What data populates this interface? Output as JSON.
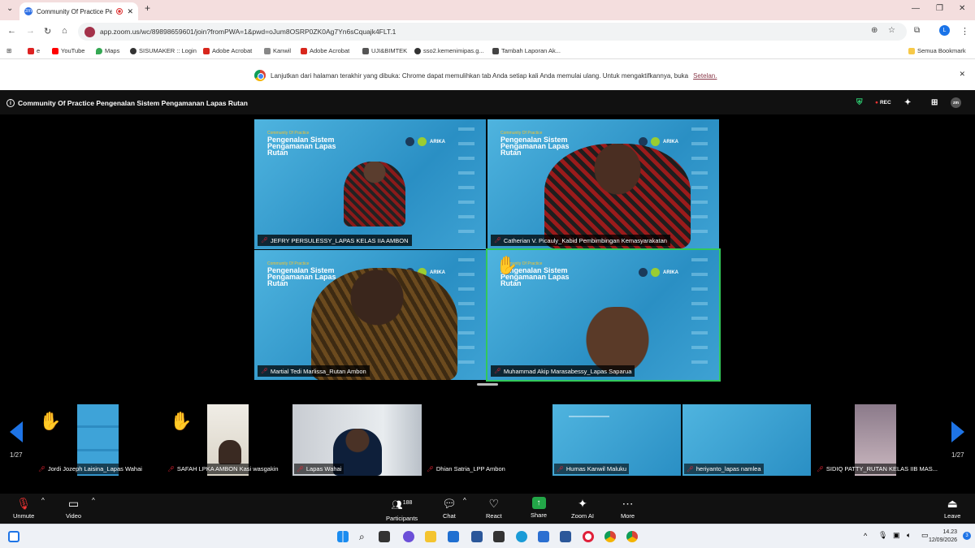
{
  "browser": {
    "tab_title": "Community Of Practice Pen",
    "url": "app.zoom.us/wc/89898659601/join?fromPWA=1&pwd=oJum8OSRP0ZK0Ag7Yn6sCquajk4FLT.1",
    "profile_initial": "L",
    "bookmarks": [
      "e",
      "YouTube",
      "Maps",
      "SISUMAKER :: Login",
      "Adobe Acrobat",
      "Kanwil",
      "Adobe Acrobat",
      "UJI&BIMTEK",
      "sso2.kemenimipas.g...",
      "Tambah Laporan Ak..."
    ],
    "all_bookmarks": "Semua Bookmark",
    "info_message": "Lanjutkan dari halaman terakhir yang dibuka: Chrome dapat memulihkan tab Anda setiap kali Anda memulai ulang. Untuk mengaktifkannya, buka",
    "info_link": "Setelan."
  },
  "meeting": {
    "title": "Community Of Practice Pengenalan Sistem Pengamanan Lapas Rutan",
    "rec_label": "REC",
    "slide_kicker": "Community Of Practice",
    "slide_title": "Pengenalan Sistem Pengamanan Lapas Rutan",
    "slide_logo": "ARIKA",
    "main_tiles": [
      {
        "name": "JEFRY PERSULESSY_LAPAS KELAS IIA AMBON"
      },
      {
        "name": "Catherian V. Picauly_Kabid Pembimbingan Kemasyarakatan"
      },
      {
        "name": "Martial Tedi Marlissa_Rutan Ambon"
      },
      {
        "name": "Muhammad Akip Marasabessy_Lapas Saparua"
      }
    ],
    "strip_tiles": [
      {
        "name": "Jordi Jozeph Laisina_Lapas Wahai"
      },
      {
        "name": "SAFAH LPKA AMBON Kasi wasgakin"
      },
      {
        "name": "Lapas Wahai"
      },
      {
        "name": "Dhian Satria_LPP Ambon"
      },
      {
        "name": "Humas Kanwil Maluku"
      },
      {
        "name": "heriyanto_lapas namlea"
      },
      {
        "name": "SIDIQ PATTY_RUTAN KELAS IIB MAS..."
      }
    ],
    "page_left": "1/27",
    "page_right": "1/27"
  },
  "toolbar": {
    "unmute": "Unmute",
    "video": "Video",
    "participants": "Participants",
    "participants_count": "188",
    "chat": "Chat",
    "react": "React",
    "share": "Share",
    "zoom_ai": "Zoom AI",
    "more": "More",
    "leave": "Leave"
  },
  "taskbar": {
    "time": "14.23",
    "date": "12/09/2026",
    "notif_count": "3"
  }
}
